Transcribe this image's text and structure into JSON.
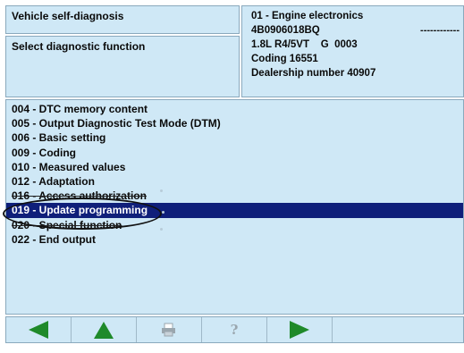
{
  "header": {
    "app_title": "Vehicle self-diagnosis",
    "function_prompt": "Select diagnostic function",
    "control_unit": {
      "line1": "01 - Engine electronics",
      "part_number": "4B0906018BQ",
      "dashes": "------------",
      "engine": "1.8L R4/5VT    G  0003",
      "coding": "Coding 16551",
      "dealership": "Dealership number 40907"
    }
  },
  "functions": [
    {
      "label": "004 - DTC memory content"
    },
    {
      "label": "005 - Output Diagnostic Test Mode (DTM)"
    },
    {
      "label": "006 - Basic setting"
    },
    {
      "label": "009 - Coding"
    },
    {
      "label": "010 - Measured values"
    },
    {
      "label": "012 - Adaptation"
    },
    {
      "label": "016 - Access authorization"
    },
    {
      "label": "019 - Update programming"
    },
    {
      "label": "020 - Special function"
    },
    {
      "label": "022 - End output"
    }
  ],
  "selected_function": "019 - Update programming",
  "toolbar": {
    "help_label": "?"
  },
  "colors": {
    "panel_bg": "#cfe8f6",
    "selection_bg": "#0f1f7a",
    "arrow_green": "#1f8a2a"
  },
  "icons": {
    "back": "arrow-left-icon",
    "up": "arrow-up-icon",
    "print": "printer-icon",
    "help": "help-icon",
    "next": "arrow-right-icon"
  }
}
